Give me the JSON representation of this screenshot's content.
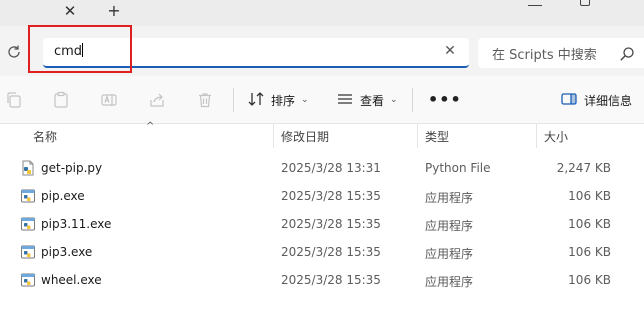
{
  "tabstrip": {
    "close_glyph": "✕",
    "new_tab_glyph": "+"
  },
  "address": {
    "value": "cmd",
    "clear_glyph": "✕"
  },
  "search": {
    "placeholder": "在 Scripts 中搜索"
  },
  "toolbar": {
    "sort_label": "排序",
    "view_label": "查看",
    "more_label": "•••",
    "details_label": "详细信息",
    "icons": [
      "copy-icon",
      "paste-icon",
      "rename-icon",
      "share-icon",
      "delete-icon",
      "sort-icon",
      "view-icon",
      "details-pane-icon"
    ]
  },
  "columns": {
    "name": "名称",
    "date": "修改日期",
    "type": "类型",
    "size": "大小",
    "sort_indicator": "^"
  },
  "files": [
    {
      "name": "get-pip.py",
      "date": "2025/3/28 13:31",
      "type": "Python File",
      "size": "2,247 KB",
      "icon": "python-file-icon"
    },
    {
      "name": "pip.exe",
      "date": "2025/3/28 15:35",
      "type": "应用程序",
      "size": "106 KB",
      "icon": "exe-icon"
    },
    {
      "name": "pip3.11.exe",
      "date": "2025/3/28 15:35",
      "type": "应用程序",
      "size": "106 KB",
      "icon": "exe-icon"
    },
    {
      "name": "pip3.exe",
      "date": "2025/3/28 15:35",
      "type": "应用程序",
      "size": "106 KB",
      "icon": "exe-icon"
    },
    {
      "name": "wheel.exe",
      "date": "2025/3/28 15:35",
      "type": "应用程序",
      "size": "106 KB",
      "icon": "exe-icon"
    }
  ],
  "colors": {
    "accent": "#1a5fb4",
    "highlight_box": "#e02020",
    "details_icon": "#1a5fb4"
  }
}
